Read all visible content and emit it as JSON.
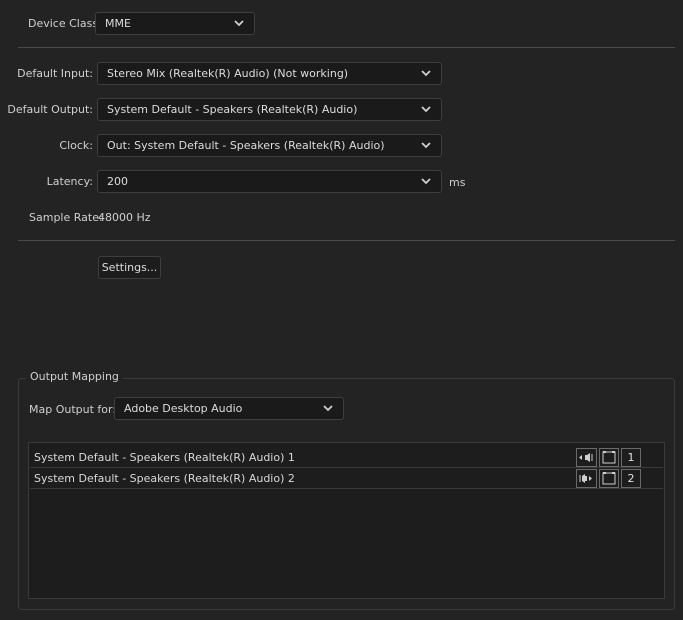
{
  "device_class": {
    "label": "Device Class:",
    "value": "MME"
  },
  "default_input": {
    "label": "Default Input:",
    "value": "Stereo Mix (Realtek(R) Audio) (Not working)"
  },
  "default_output": {
    "label": "Default Output:",
    "value": "System Default - Speakers (Realtek(R) Audio)"
  },
  "clock": {
    "label": "Clock:",
    "value": "Out: System Default - Speakers (Realtek(R) Audio)"
  },
  "latency": {
    "label": "Latency:",
    "value": "200",
    "unit": "ms"
  },
  "sample_rate": {
    "label": "Sample Rate:",
    "value": "48000 Hz"
  },
  "settings_button": "Settings...",
  "output_mapping": {
    "title": "Output Mapping",
    "map_for_label": "Map Output for:",
    "map_for_value": "Adobe Desktop Audio",
    "channels": [
      {
        "name": "System Default - Speakers (Realtek(R) Audio) 1",
        "number": "1",
        "speaker_icon": "speaker-left-icon"
      },
      {
        "name": "System Default - Speakers (Realtek(R) Audio) 2",
        "number": "2",
        "speaker_icon": "speaker-right-icon"
      }
    ]
  },
  "colors": {
    "background": "#232323",
    "field": "#1a1a1a",
    "border": "#3e3e3e",
    "text": "#cfcfcf"
  }
}
